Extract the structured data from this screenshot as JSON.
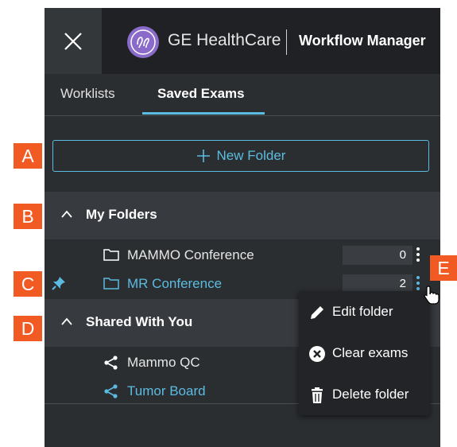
{
  "header": {
    "brand": "GE HealthCare",
    "product": "Workflow Manager"
  },
  "tabs": [
    {
      "label": "Worklists",
      "active": false
    },
    {
      "label": "Saved Exams",
      "active": true
    }
  ],
  "new_folder_label": "New Folder",
  "sections": {
    "my_folders": {
      "title": "My Folders",
      "items": [
        {
          "label": "MAMMO Conference",
          "count": "0"
        },
        {
          "label": "MR Conference",
          "count": "2"
        }
      ]
    },
    "shared": {
      "title": "Shared With You",
      "items": [
        {
          "label": "Mammo QC"
        },
        {
          "label": "Tumor Board"
        }
      ]
    }
  },
  "context_menu": [
    {
      "label": "Edit folder",
      "icon": "pencil-icon"
    },
    {
      "label": "Clear exams",
      "icon": "clear-circle-icon"
    },
    {
      "label": "Delete folder",
      "icon": "trash-icon"
    }
  ],
  "markers": [
    "A",
    "B",
    "C",
    "D",
    "E"
  ],
  "colors": {
    "accent": "#5bbbe0",
    "marker": "#f15a22",
    "panel": "#2b2e31"
  }
}
